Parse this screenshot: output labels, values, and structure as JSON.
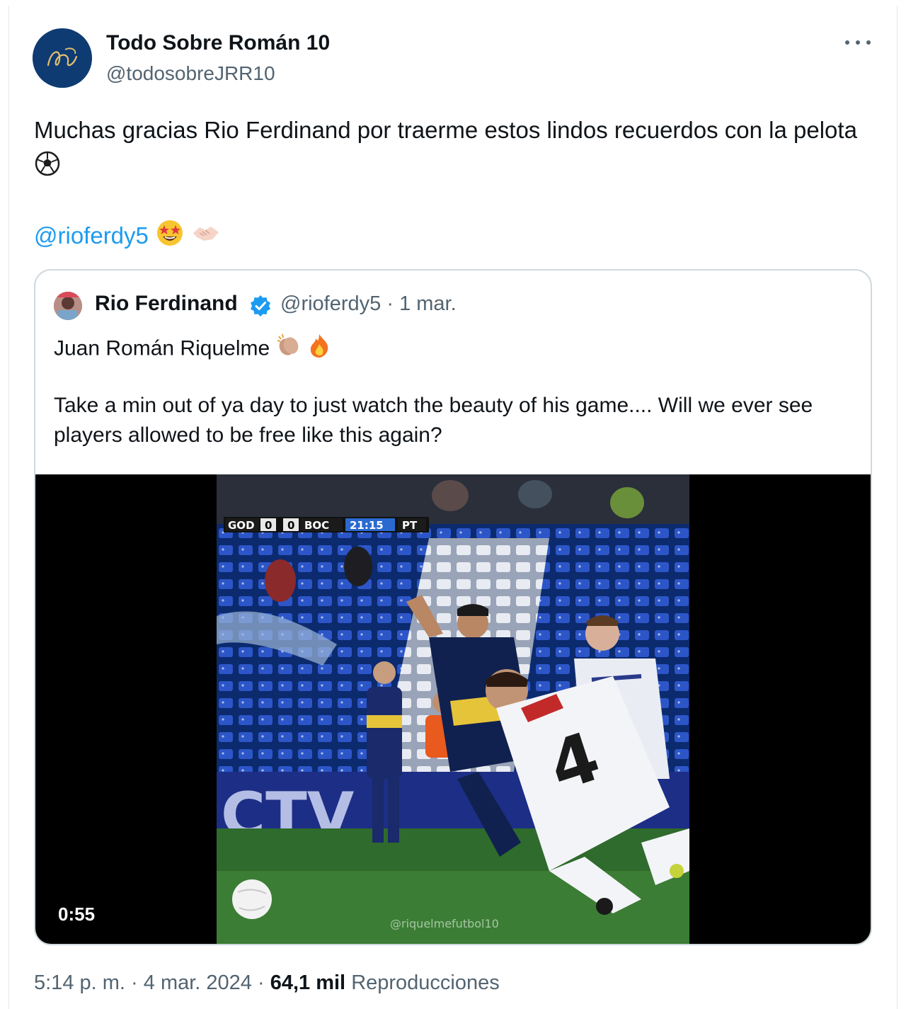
{
  "tweet": {
    "author_name": "Todo Sobre Román 10",
    "author_handle": "@todosobreJRR10",
    "text": "Muchas gracias Rio Ferdinand por traerme estos lindos recuerdos con la pelota",
    "mention": "@rioferdy5",
    "time": "5:14 p. m.",
    "date": "4 mar. 2024",
    "views_count": "64,1 mil",
    "views_label": "Reproducciones",
    "separator": "·"
  },
  "quoted": {
    "author_name": "Rio Ferdinand",
    "author_handle": "@rioferdy5",
    "date": "1 mar.",
    "line1": "Juan Román Riquelme",
    "line2": "Take a min out of ya day to just watch the beauty of his game.... Will we ever see players allowed to be free like this again?",
    "video": {
      "duration": "0:55",
      "scoreboard": [
        "GOD",
        "0",
        "0",
        "BOC",
        "21:15",
        "PT"
      ],
      "shirt_number": "4",
      "board_text": "CTV",
      "watermark": "@riquelmefutbol10"
    }
  },
  "colors": {
    "link": "#1d9bf0",
    "secondary_text": "#536471",
    "verified": "#1d9bf0",
    "border": "#cfd9de"
  },
  "icons": [
    "more-icon",
    "soccer-ball-emoji",
    "star-struck-emoji",
    "handshake-emoji",
    "verified-badge-icon",
    "clapping-hands-emoji",
    "fire-emoji"
  ]
}
